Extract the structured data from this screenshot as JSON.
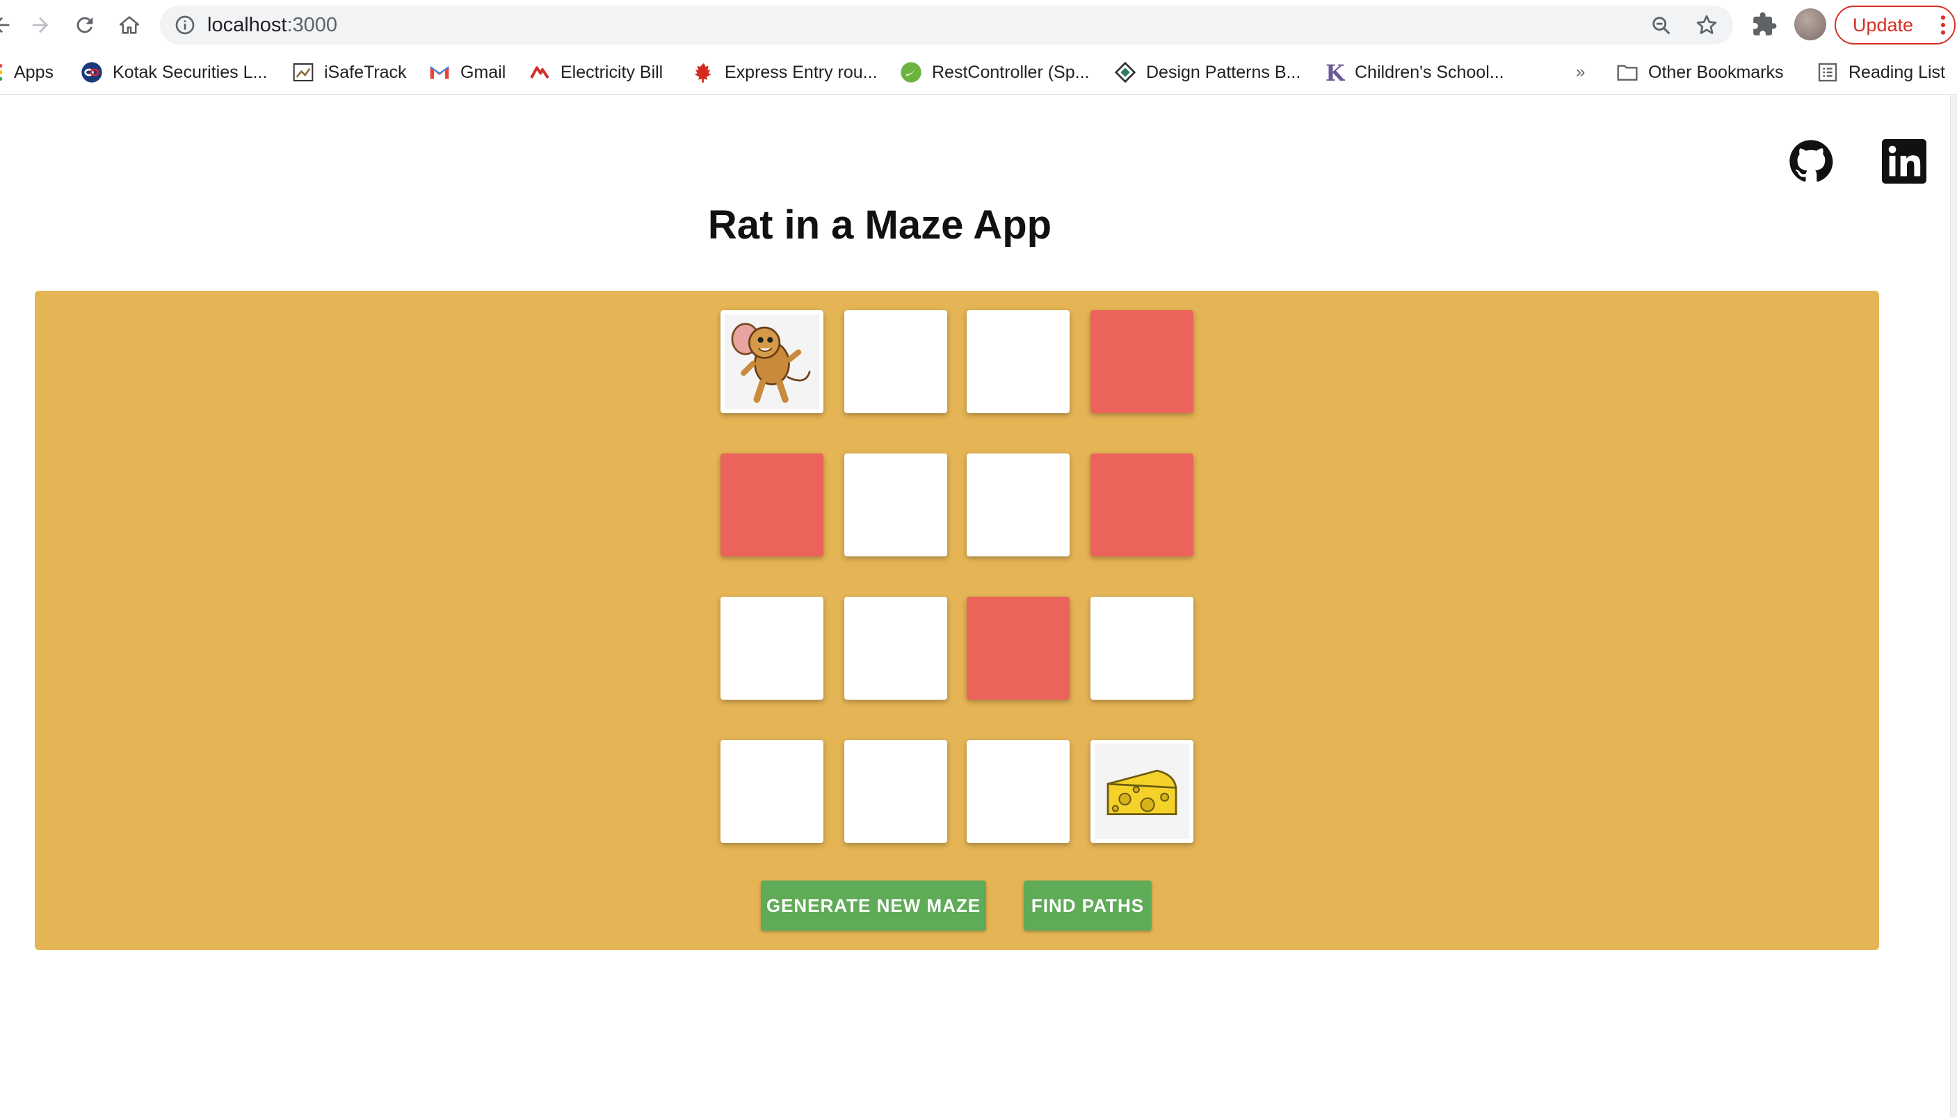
{
  "browser": {
    "url_host": "localhost",
    "url_port": ":3000",
    "update_label": "Update"
  },
  "bookmarks": {
    "items": [
      {
        "label": "Apps",
        "icon": "apps-grid-icon"
      },
      {
        "label": "Kotak Securities L...",
        "icon": "kotak-icon"
      },
      {
        "label": "iSafeTrack",
        "icon": "isafetrack-icon"
      },
      {
        "label": "Gmail",
        "icon": "gmail-icon"
      },
      {
        "label": "Electricity Bill",
        "icon": "electricity-icon"
      },
      {
        "label": "Express Entry rou...",
        "icon": "maple-leaf-icon"
      },
      {
        "label": "RestController (Sp...",
        "icon": "spring-icon"
      },
      {
        "label": "Design Patterns B...",
        "icon": "design-patterns-icon"
      },
      {
        "label": "Children's School...",
        "icon": "k-letter-icon"
      }
    ],
    "overflow": "»",
    "other": "Other Bookmarks",
    "reading_list": "Reading List"
  },
  "app": {
    "title": "Rat in a Maze App",
    "social": [
      "github-icon",
      "linkedin-icon"
    ]
  },
  "maze": {
    "rows": 4,
    "cols": 4,
    "grid": [
      [
        "rat",
        "open",
        "open",
        "blocked"
      ],
      [
        "blocked",
        "open",
        "open",
        "blocked"
      ],
      [
        "open",
        "open",
        "blocked",
        "open"
      ],
      [
        "open",
        "open",
        "open",
        "cheese"
      ]
    ],
    "colors": {
      "panel": "#e4b455",
      "blocked": "#ec635b",
      "open": "#ffffff",
      "button": "#5fab57"
    }
  },
  "actions": {
    "generate_label": "GENERATE NEW MAZE",
    "find_label": "FIND PATHS"
  }
}
